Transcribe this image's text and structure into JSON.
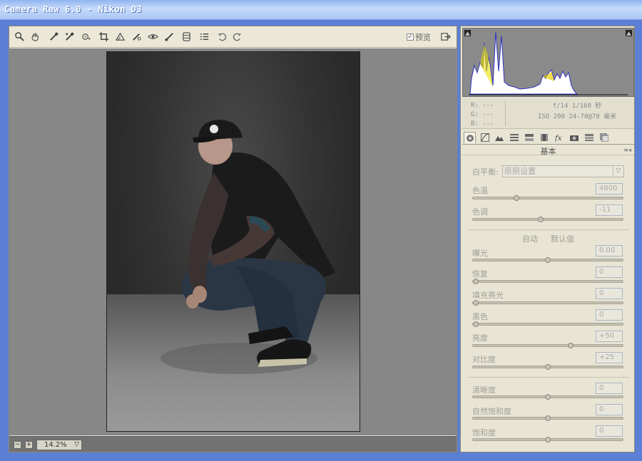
{
  "window": {
    "title": "Camera Raw 6.0 -  Nikon D3"
  },
  "toolbar": {
    "tools": [
      "zoom-icon",
      "hand-icon",
      "white-balance-icon",
      "color-sampler-icon",
      "target-adjust-icon",
      "crop-icon",
      "straighten-icon",
      "spot-removal-icon",
      "red-eye-icon",
      "adjustment-brush-icon",
      "graduated-filter-icon",
      "preferences-icon",
      "rotate-left-icon",
      "rotate-right-icon"
    ],
    "preview_label": "预览",
    "preview_checked": "✓"
  },
  "status": {
    "zoom_value": "14.2%",
    "zoom_out": "−",
    "zoom_in": "+"
  },
  "info": {
    "r": "R: ---",
    "g": "G: ---",
    "b": "B: ---",
    "exif_line1": "f/14  1/160 秒",
    "exif_line2": "ISO 200  24-70@70 毫米"
  },
  "panel": {
    "title": "基本",
    "white_balance": {
      "label": "白平衡:",
      "value": "原照设置"
    },
    "temperature": {
      "label": "色温",
      "value": "4800",
      "level": 0.28
    },
    "tint": {
      "label": "色调",
      "value": "-11",
      "level": 0.45
    },
    "auto_label": "自动",
    "default_label": "默认值",
    "exposure": {
      "label": "曝光",
      "value": "0.00",
      "level": 0.5
    },
    "recovery": {
      "label": "恢复",
      "value": "0",
      "level": 0.0
    },
    "fill_light": {
      "label": "填充亮光",
      "value": "0",
      "level": 0.0
    },
    "blacks": {
      "label": "黑色",
      "value": "0",
      "level": 0.0
    },
    "brightness": {
      "label": "亮度",
      "value": "+50",
      "level": 0.66
    },
    "contrast": {
      "label": "对比度",
      "value": "+25",
      "level": 0.5
    },
    "clarity": {
      "label": "清晰度",
      "value": "0",
      "level": 0.5
    },
    "vibrance": {
      "label": "自然饱和度",
      "value": "0",
      "level": 0.5
    },
    "saturation": {
      "label": "饱和度",
      "value": "0",
      "level": 0.5
    }
  }
}
